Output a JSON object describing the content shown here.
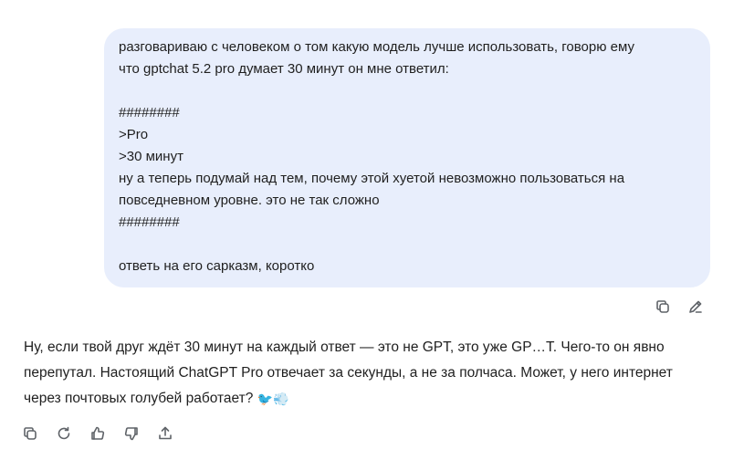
{
  "user_message": {
    "lines": [
      "разговариваю с человеком о том какую модель лучше использовать, говорю ему",
      "что gptchat 5.2 pro думает 30 минут он мне ответил:",
      "",
      "########",
      ">Pro",
      ">30 минут",
      "ну а теперь подумай над тем, почему этой хуетой невозможно пользоваться на",
      "повседневном уровне. это не так сложно",
      "########",
      "",
      "ответь на его сарказм, коротко"
    ],
    "actions": {
      "copy_icon": "copy-icon",
      "edit_icon": "pencil-icon"
    }
  },
  "assistant_message": {
    "lines": [
      "Ну, если твой друг ждёт 30 минут на каждый ответ — это не GPT, это уже GP…Т. Чего-то он явно",
      "перепутал. Настоящий ChatGPT Pro отвечает за секунды, а не за полчаса. Может, у него интернет",
      "через почтовых голубей работает? "
    ],
    "emoji": [
      "🐦",
      "💨"
    ],
    "actions": [
      "copy-icon",
      "regenerate-icon",
      "thumbs-up-icon",
      "thumbs-down-icon",
      "share-icon"
    ]
  },
  "colors": {
    "user_bubble_bg": "#e8eefc",
    "text": "#1f1f1f",
    "icon": "#5f6368"
  }
}
